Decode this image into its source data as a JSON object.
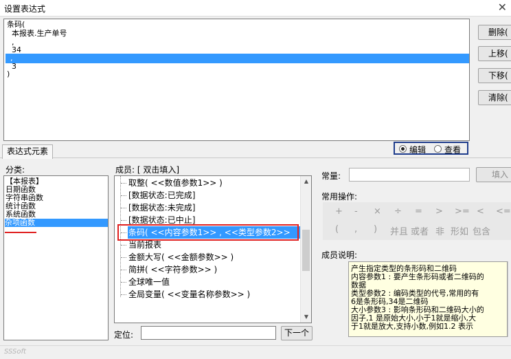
{
  "window": {
    "title": "设置表达式",
    "close_glyph": "✕"
  },
  "editor": {
    "lines": [
      "条码(",
      "  本报表.生产单号",
      "  ,",
      "  34",
      "  ,",
      "  3",
      ")"
    ],
    "selected_line_index": 4
  },
  "side_buttons": {
    "delete": "删除(",
    "up": "上移(",
    "down": "下移(",
    "clear": "清除("
  },
  "tab": {
    "label": "表达式元素"
  },
  "mode": {
    "options": [
      "编辑",
      "查看"
    ],
    "selected": "编辑"
  },
  "category": {
    "label": "分类:",
    "items": [
      "【本报表】",
      "日期函数",
      "字符串函数",
      "统计函数",
      "系统函数",
      "杂项函数"
    ],
    "selected": "杂项函数"
  },
  "members": {
    "label": "成员: [ 双击填入]",
    "items": [
      "取整( <<数值参数1>> )",
      "[数据状态:已完成]",
      "[数据状态:未完成]",
      "[数据状态:已中止]",
      "条码( <<内容参数1>>  ,  <<类型参数2>>",
      "当前报表",
      "金额大写( <<金额参数>> )",
      "简拼( <<字符参数>> )",
      "全球唯一值",
      "全局变量( <<变量名称参数>> )"
    ],
    "selected_index": 4
  },
  "locate": {
    "label": "定位:",
    "value": "",
    "next_button": "下一个"
  },
  "constant": {
    "label": "常量:",
    "value": "",
    "fill_button": "填入"
  },
  "common_ops": {
    "label": "常用操作:",
    "row1": [
      "+",
      "-",
      "×",
      "÷",
      "=",
      ">",
      ">=",
      "<",
      "<="
    ],
    "row2": [
      "(",
      ",",
      ")",
      "并且",
      "或者",
      "非",
      "形如",
      "包含"
    ]
  },
  "description": {
    "label": "成员说明:",
    "lines": [
      "产生指定类型的条形码和二维码",
      "内容参数1 : 要产生条形码或者二维码的",
      "数据",
      "类型参数2 : 编码类型的代号,常用的有",
      "6是条形码,34是二维码",
      "大小参数3 : 影响条形码和二维码大小的",
      "因子,1 是原始大小,小于1就是缩小,大",
      "于1就是放大,支持小数,例如1.2 表示"
    ]
  },
  "status_bar": {
    "text": "SSSoft"
  },
  "colors": {
    "selection": "#3399ff",
    "annotation_red": "#e02020",
    "mode_border": "#1e3c8c",
    "tooltip_bg": "#ffffe1"
  }
}
